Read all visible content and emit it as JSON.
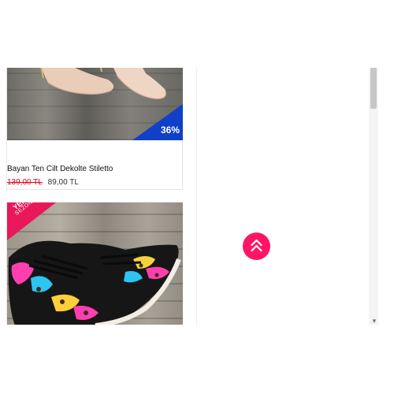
{
  "products": [
    {
      "title": "Bayan Ten Cilt Dekolte Stiletto",
      "old_price": "139,00 TL",
      "new_price": "89,00 TL",
      "discount_label": "36%",
      "image_icon": "nude-stiletto-image"
    },
    {
      "ribbon_main": "YENİ",
      "ribbon_sub": "SEZON",
      "image_icon": "colorful-sneaker-image"
    }
  ],
  "colors": {
    "discount_badge": "#1040c8",
    "ribbon": "#e8185a",
    "scroll_top_button": "#ff1466",
    "old_price": "#e0001b"
  },
  "scroll_top": {
    "icon": "double-chevron-up-icon"
  }
}
